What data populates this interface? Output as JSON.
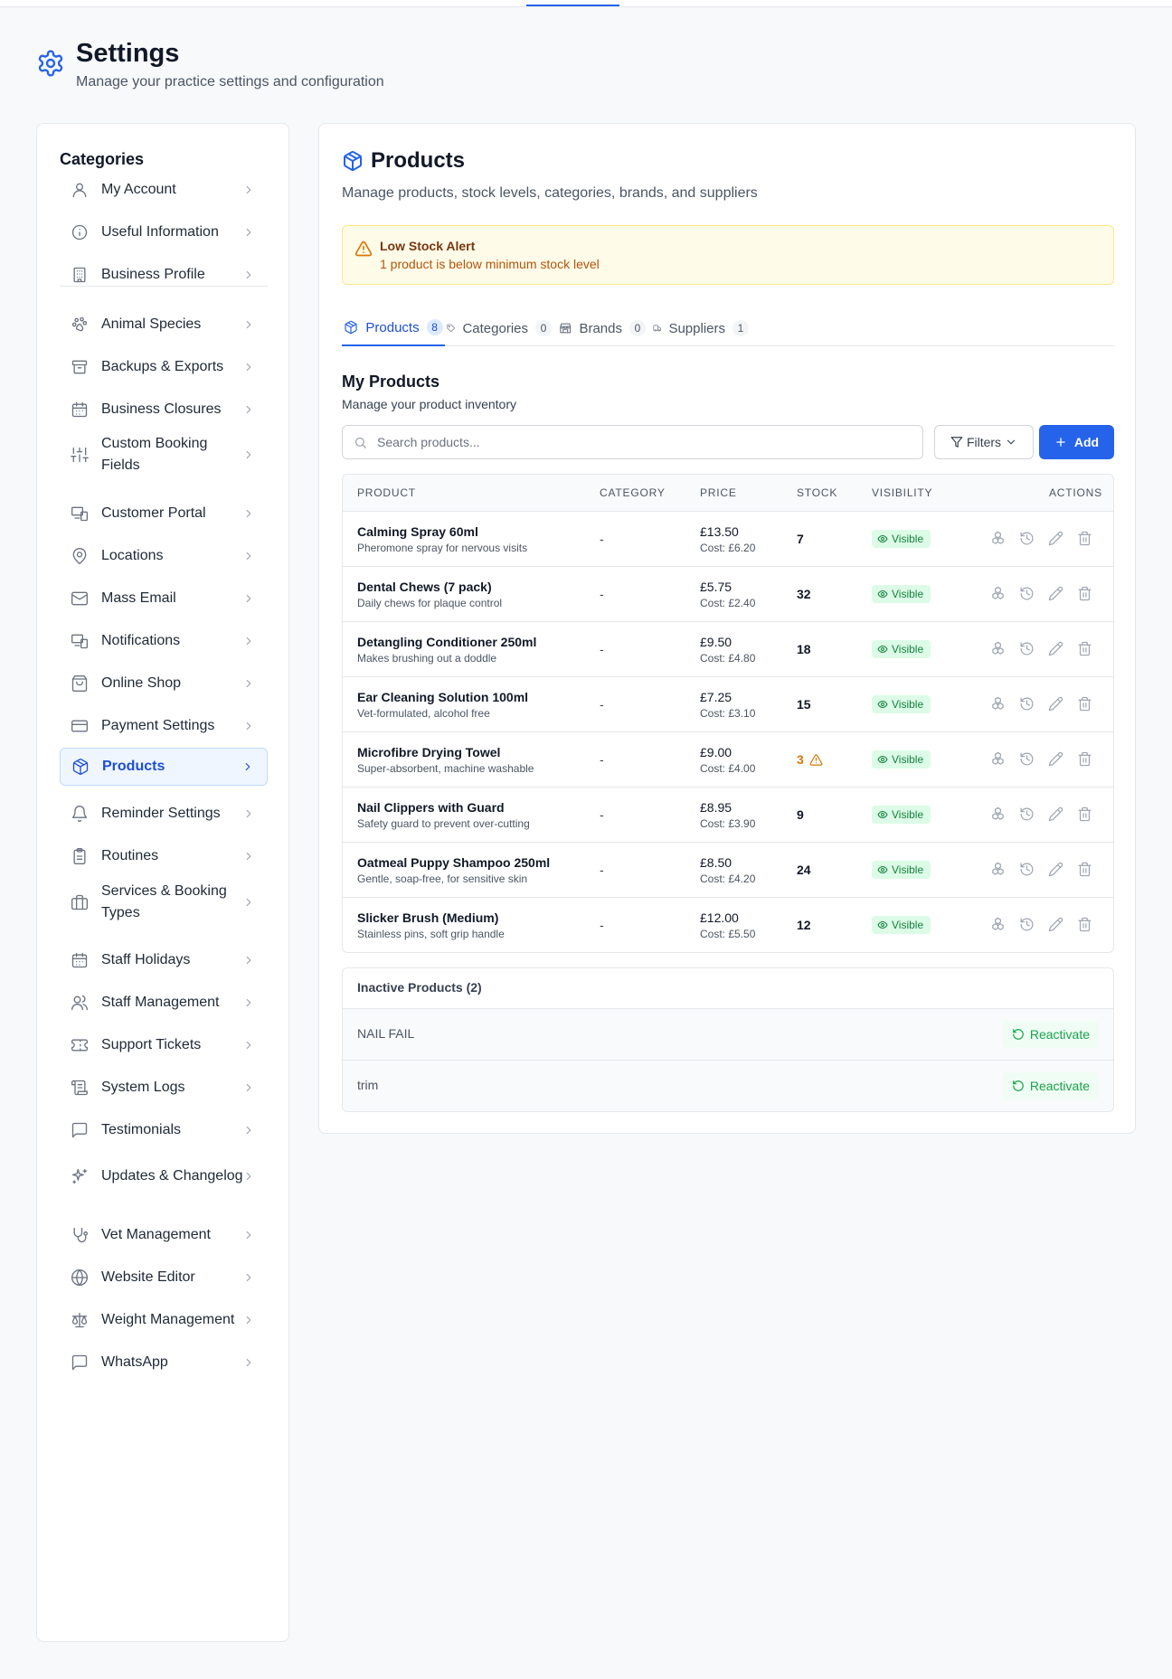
{
  "header": {
    "title": "Settings",
    "subtitle": "Manage your practice settings and configuration"
  },
  "sidebar": {
    "title": "Categories",
    "items": [
      {
        "label": "My Account",
        "icon": "user-icon"
      },
      {
        "label": "Useful Information",
        "icon": "info-icon"
      },
      {
        "label": "Business Profile",
        "icon": "building-icon"
      },
      {
        "label": "Animal Species",
        "icon": "paw-icon"
      },
      {
        "label": "Backups & Exports",
        "icon": "archive-icon"
      },
      {
        "label": "Business Closures",
        "icon": "calendar-icon"
      },
      {
        "label": "Custom Booking Fields",
        "icon": "sliders-icon"
      },
      {
        "label": "Customer Portal",
        "icon": "devices-icon"
      },
      {
        "label": "Locations",
        "icon": "map-pin-icon"
      },
      {
        "label": "Mass Email",
        "icon": "mail-icon"
      },
      {
        "label": "Notifications",
        "icon": "devices-icon"
      },
      {
        "label": "Online Shop",
        "icon": "shopping-bag-icon"
      },
      {
        "label": "Payment Settings",
        "icon": "credit-card-icon"
      },
      {
        "label": "Products",
        "icon": "package-icon",
        "active": true
      },
      {
        "label": "Reminder Settings",
        "icon": "bell-icon"
      },
      {
        "label": "Routines",
        "icon": "clipboard-icon"
      },
      {
        "label": "Services & Booking Types",
        "icon": "briefcase-icon"
      },
      {
        "label": "Staff Holidays",
        "icon": "calendar-icon"
      },
      {
        "label": "Staff Management",
        "icon": "users-icon"
      },
      {
        "label": "Support Tickets",
        "icon": "ticket-icon"
      },
      {
        "label": "System Logs",
        "icon": "scroll-icon"
      },
      {
        "label": "Testimonials",
        "icon": "message-square-icon"
      },
      {
        "label": "Updates & Changelog",
        "icon": "sparkles-icon"
      },
      {
        "label": "Vet Management",
        "icon": "stethoscope-icon"
      },
      {
        "label": "Website Editor",
        "icon": "globe-icon"
      },
      {
        "label": "Weight Management",
        "icon": "scale-icon"
      },
      {
        "label": "WhatsApp",
        "icon": "message-square-icon"
      }
    ]
  },
  "main": {
    "title": "Products",
    "subtitle": "Manage products, stock levels, categories, brands, and suppliers",
    "alert": {
      "title": "Low Stock Alert",
      "description": "1 product is below minimum stock level"
    },
    "tabs": [
      {
        "label": "Products",
        "count": "8",
        "icon": "package-icon",
        "active": true
      },
      {
        "label": "Categories",
        "count": "0",
        "icon": "tag-icon"
      },
      {
        "label": "Brands",
        "count": "0",
        "icon": "store-icon"
      },
      {
        "label": "Suppliers",
        "count": "1",
        "icon": "truck-icon"
      }
    ],
    "section_title": "My Products",
    "section_subtitle": "Manage your product inventory",
    "search_placeholder": "Search products...",
    "filters_label": "Filters",
    "add_label": "Add",
    "columns": [
      "PRODUCT",
      "CATEGORY",
      "PRICE",
      "STOCK",
      "VISIBILITY",
      "ACTIONS"
    ],
    "products": [
      {
        "name": "Calming Spray 60ml",
        "description": "Pheromone spray for nervous visits",
        "category": "-",
        "price": "£13.50",
        "cost": "Cost: £6.20",
        "stock": "7",
        "low": false,
        "visibility": "Visible"
      },
      {
        "name": "Dental Chews (7 pack)",
        "description": "Daily chews for plaque control",
        "category": "-",
        "price": "£5.75",
        "cost": "Cost: £2.40",
        "stock": "32",
        "low": false,
        "visibility": "Visible"
      },
      {
        "name": "Detangling Conditioner 250ml",
        "description": "Makes brushing out a doddle",
        "category": "-",
        "price": "£9.50",
        "cost": "Cost: £4.80",
        "stock": "18",
        "low": false,
        "visibility": "Visible"
      },
      {
        "name": "Ear Cleaning Solution 100ml",
        "description": "Vet-formulated, alcohol free",
        "category": "-",
        "price": "£7.25",
        "cost": "Cost: £3.10",
        "stock": "15",
        "low": false,
        "visibility": "Visible"
      },
      {
        "name": "Microfibre Drying Towel",
        "description": "Super-absorbent, machine washable",
        "category": "-",
        "price": "£9.00",
        "cost": "Cost: £4.00",
        "stock": "3",
        "low": true,
        "visibility": "Visible"
      },
      {
        "name": "Nail Clippers with Guard",
        "description": "Safety guard to prevent over-cutting",
        "category": "-",
        "price": "£8.95",
        "cost": "Cost: £3.90",
        "stock": "9",
        "low": false,
        "visibility": "Visible"
      },
      {
        "name": "Oatmeal Puppy Shampoo 250ml",
        "description": "Gentle, soap-free, for sensitive skin",
        "category": "-",
        "price": "£8.50",
        "cost": "Cost: £4.20",
        "stock": "24",
        "low": false,
        "visibility": "Visible"
      },
      {
        "name": "Slicker Brush (Medium)",
        "description": "Stainless pins, soft grip handle",
        "category": "-",
        "price": "£12.00",
        "cost": "Cost: £5.50",
        "stock": "12",
        "low": false,
        "visibility": "Visible"
      }
    ],
    "row_actions": [
      "variants-icon",
      "history-icon",
      "edit-icon",
      "delete-icon"
    ],
    "inactive": {
      "title": "Inactive Products (2)",
      "items": [
        {
          "name": "NAIL FAIL",
          "action": "Reactivate"
        },
        {
          "name": "trim",
          "action": "Reactivate"
        }
      ]
    }
  },
  "colors": {
    "accent": "#2563eb",
    "warning": "#d97706",
    "success": "#15803d"
  }
}
